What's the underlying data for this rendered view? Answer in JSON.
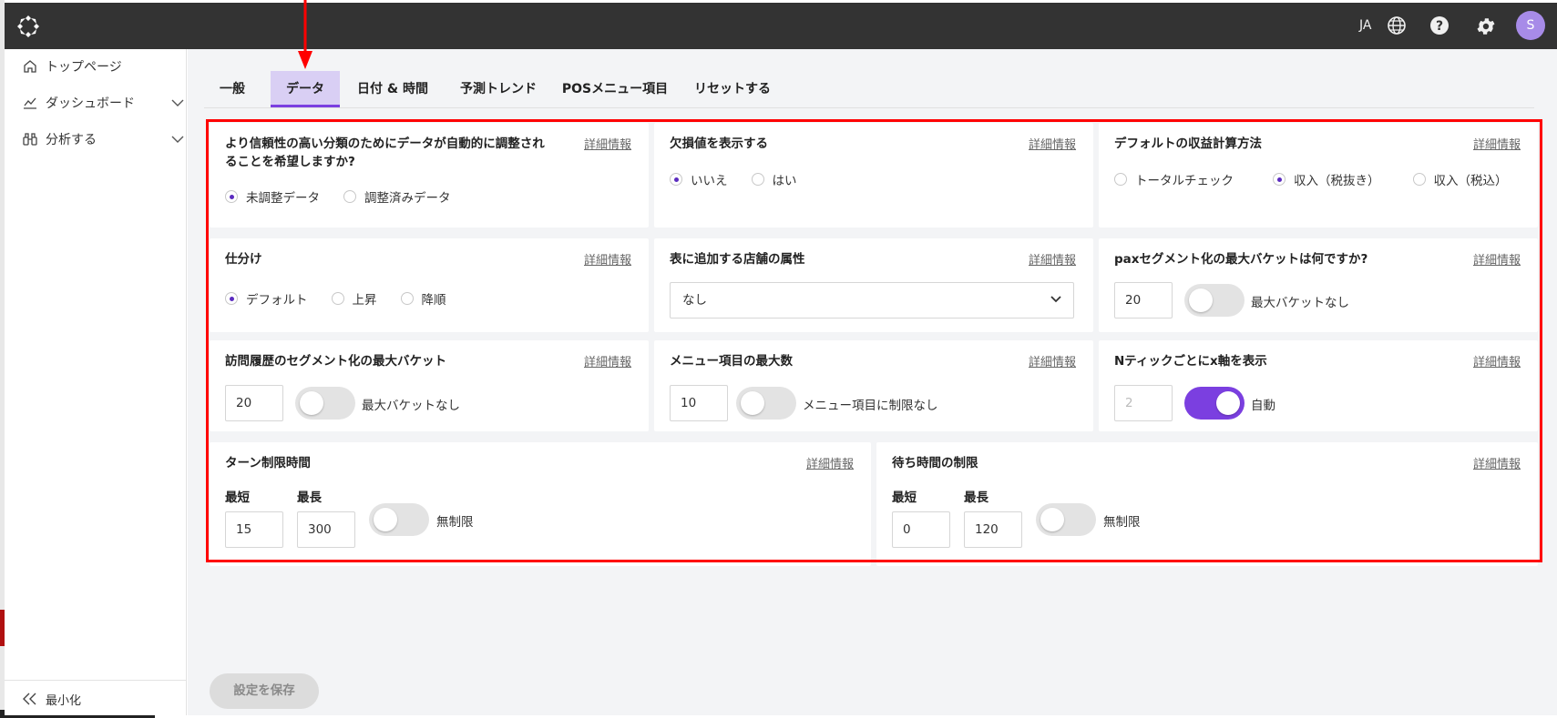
{
  "header": {
    "language": "JA",
    "avatar_initial": "S"
  },
  "sidebar": {
    "items": [
      {
        "label": "トップページ"
      },
      {
        "label": "ダッシュボード"
      },
      {
        "label": "分析する"
      }
    ],
    "minimize_label": "最小化"
  },
  "tabs": [
    {
      "label": "一般"
    },
    {
      "label": "データ",
      "active": true
    },
    {
      "label": "日付 & 時間"
    },
    {
      "label": "予測トレンド"
    },
    {
      "label": "POSメニュー項目"
    },
    {
      "label": "リセットする"
    }
  ],
  "details_link": "詳細情報",
  "cards": {
    "auto_adjust": {
      "title_line1": "より信頼性の高い分類のためにデータが自動的に調整され",
      "title_line2": "ることを希望しますか?",
      "options": [
        "未調整データ",
        "調整済みデータ"
      ],
      "selected": "未調整データ"
    },
    "missing_values": {
      "title": "欠損値を表示する",
      "options": [
        "いいえ",
        "はい"
      ],
      "selected": "いいえ"
    },
    "revenue_method": {
      "title": "デフォルトの収益計算方法",
      "options": [
        "トータルチェック",
        "収入（税抜き）",
        "収入（税込）"
      ],
      "selected": "収入（税抜き）"
    },
    "sorting": {
      "title": "仕分け",
      "options": [
        "デフォルト",
        "上昇",
        "降順"
      ],
      "selected": "デフォルト"
    },
    "store_attribute": {
      "title": "表に追加する店舗の属性",
      "selected_value": "なし"
    },
    "pax_bucket": {
      "title": "paxセグメント化の最大バケットは何ですか?",
      "value": "20",
      "toggle_label": "最大バケットなし",
      "toggle_on": false
    },
    "visit_bucket": {
      "title": "訪問履歴のセグメント化の最大バケット",
      "value": "20",
      "toggle_label": "最大バケットなし",
      "toggle_on": false
    },
    "menu_max": {
      "title": "メニュー項目の最大数",
      "value": "10",
      "toggle_label": "メニュー項目に制限なし",
      "toggle_on": false
    },
    "x_axis": {
      "title": "Nティックごとにx軸を表示",
      "value": "2",
      "toggle_label": "自動",
      "toggle_on": true
    },
    "turn_limit": {
      "title": "ターン制限時間",
      "min_label": "最短",
      "max_label": "最長",
      "min_value": "15",
      "max_value": "300",
      "toggle_label": "無制限",
      "toggle_on": false
    },
    "wait_limit": {
      "title": "待ち時間の制限",
      "min_label": "最短",
      "max_label": "最長",
      "min_value": "0",
      "max_value": "120",
      "toggle_label": "無制限",
      "toggle_on": false
    }
  },
  "save_button": "設定を保存",
  "colors": {
    "accent": "#7b3fe0",
    "active_tab_bg": "#d9cff4",
    "topbar": "#333333",
    "annotation": "#ff0000"
  }
}
